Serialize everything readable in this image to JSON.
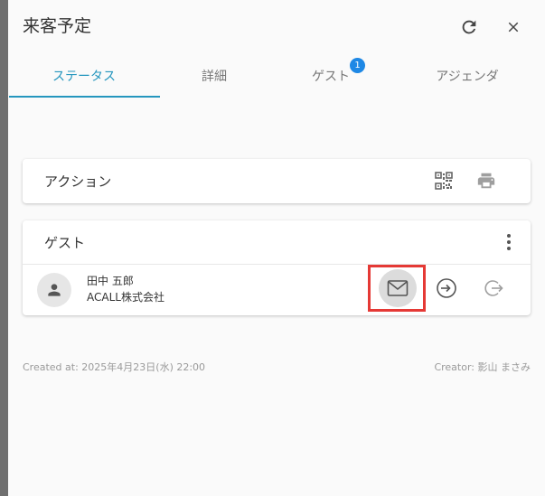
{
  "header": {
    "title": "来客予定",
    "icons": {
      "refresh": "refresh-icon",
      "close": "close-icon"
    }
  },
  "tabs": [
    {
      "label": "ステータス",
      "active": true
    },
    {
      "label": "詳細",
      "active": false
    },
    {
      "label": "ゲスト",
      "active": false,
      "badge": "1"
    },
    {
      "label": "アジェンダ",
      "active": false
    }
  ],
  "actions_card": {
    "title": "アクション",
    "icons": [
      "qr-code-icon",
      "print-icon"
    ]
  },
  "guests_card": {
    "title": "ゲスト",
    "guests": [
      {
        "name": "田中 五郎",
        "company": "ACALL株式会社"
      }
    ],
    "row_icons": [
      "mail-icon",
      "check-in-icon",
      "check-out-icon"
    ]
  },
  "footer": {
    "created": "Created at: 2025年4月23日(水) 22:00",
    "creator": "Creator: 影山 まさみ"
  },
  "colors": {
    "accent": "#2596be",
    "badge": "#1e88e5",
    "highlight_border": "#e53935"
  }
}
